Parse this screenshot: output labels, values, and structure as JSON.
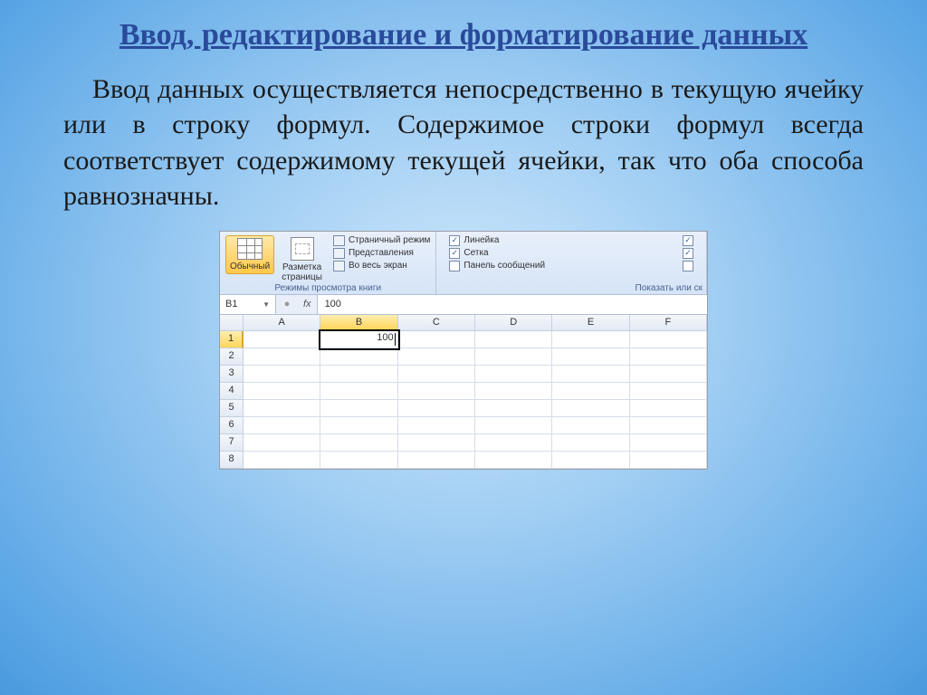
{
  "slide": {
    "title": "Ввод, редактирование и форматирование данных",
    "body": "Ввод данных осуществляется непосредственно в текущую ячейку или в строку формул. Содержимое строки формул всегда соответствует содержимому текущей ячейки, так что оба способа равнозначны."
  },
  "excel": {
    "ribbon": {
      "viewGroupLabel": "Режимы просмотра книги",
      "showGroupLabel": "Показать или ск",
      "buttons": {
        "normal": "Обычный",
        "pageLayout1": "Разметка",
        "pageLayout2": "страницы",
        "pageBreak": "Страничный режим",
        "customViews": "Представления",
        "fullScreen": "Во весь экран"
      },
      "checks": {
        "ruler": "Линейка",
        "gridlines": "Сетка",
        "messagePanel": "Панель сообщений"
      },
      "checkValues": {
        "ruler": "✓",
        "gridlines": "✓",
        "messagePanel": ""
      },
      "rightChecks": {
        "c1": "✓",
        "c2": "✓",
        "c3": ""
      }
    },
    "formulaBar": {
      "nameBox": "B1",
      "fx": "fx",
      "value": "100"
    },
    "sheet": {
      "cols": [
        "A",
        "B",
        "C",
        "D",
        "E",
        "F"
      ],
      "rows": [
        "1",
        "2",
        "3",
        "4",
        "5",
        "6",
        "7",
        "8"
      ],
      "activeCell": "B1",
      "cellValue": "100"
    }
  }
}
